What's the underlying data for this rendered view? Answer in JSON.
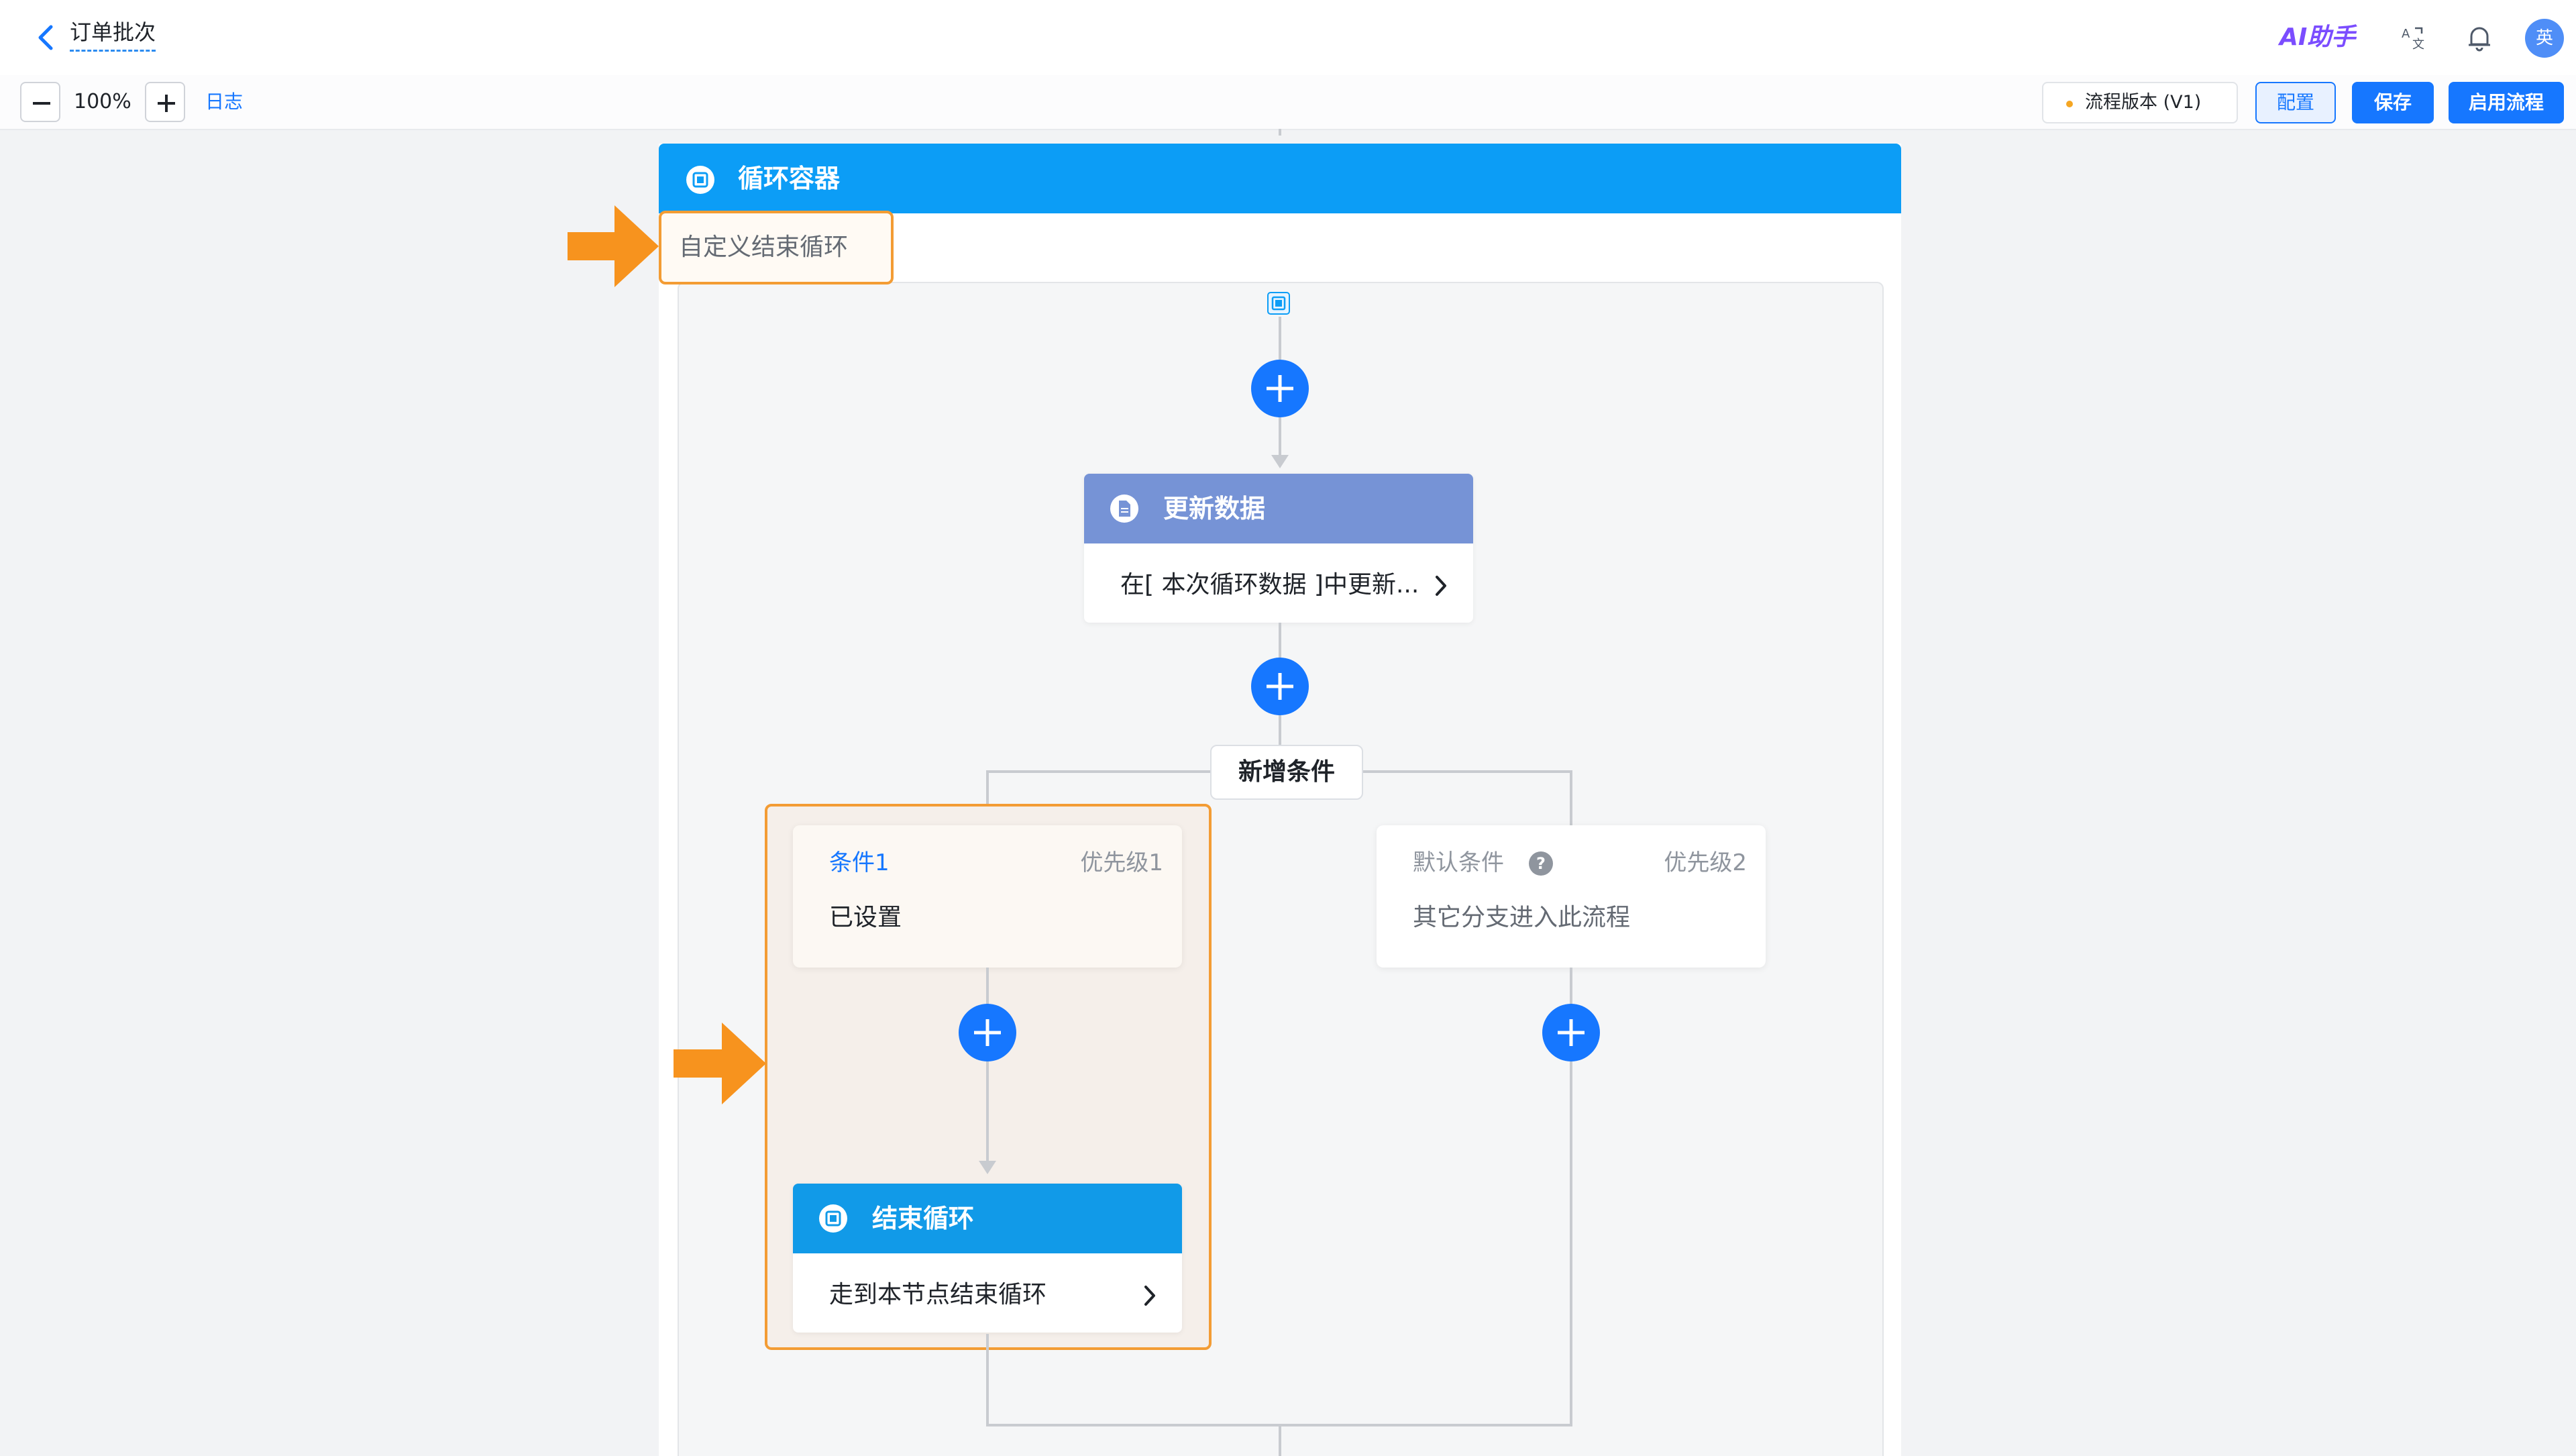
{
  "header": {
    "back_icon": "chevron-left-icon",
    "title": "订单批次",
    "ai_assistant": "AI助手",
    "translate_icon": "translate-icon",
    "bell_icon": "bell-icon",
    "avatar_text": "英"
  },
  "toolbar": {
    "zoom_out_icon": "minus-icon",
    "zoom_value": "100%",
    "zoom_in_icon": "plus-icon",
    "log_link": "日志",
    "version_label": "流程版本 (V1)",
    "config_label": "配置",
    "save_label": "保存",
    "enable_label": "启用流程"
  },
  "canvas": {
    "loop_container": {
      "icon": "loop-container-icon",
      "title": "循环容器",
      "custom_end_label": "自定义结束循环"
    },
    "update_node": {
      "icon": "document-icon",
      "title": "更新数据",
      "summary": "在[ 本次循环数据 ]中更新..."
    },
    "add_condition_label": "新增条件",
    "branches": [
      {
        "name": "条件1",
        "priority": "优先级1",
        "status": "已设置"
      },
      {
        "name": "默认条件",
        "priority": "优先级2",
        "status": "其它分支进入此流程",
        "help_icon": "question-circle-icon"
      }
    ],
    "end_loop_node": {
      "icon": "loop-end-icon",
      "title": "结束循环",
      "summary": "走到本节点结束循环"
    },
    "annotation_icons": [
      "orange-arrow-icon",
      "orange-arrow-icon"
    ],
    "colors": {
      "primary": "#1677ff",
      "loop_header": "#0c9df6",
      "update_header": "#7693d6",
      "highlight": "#f39c34"
    }
  }
}
